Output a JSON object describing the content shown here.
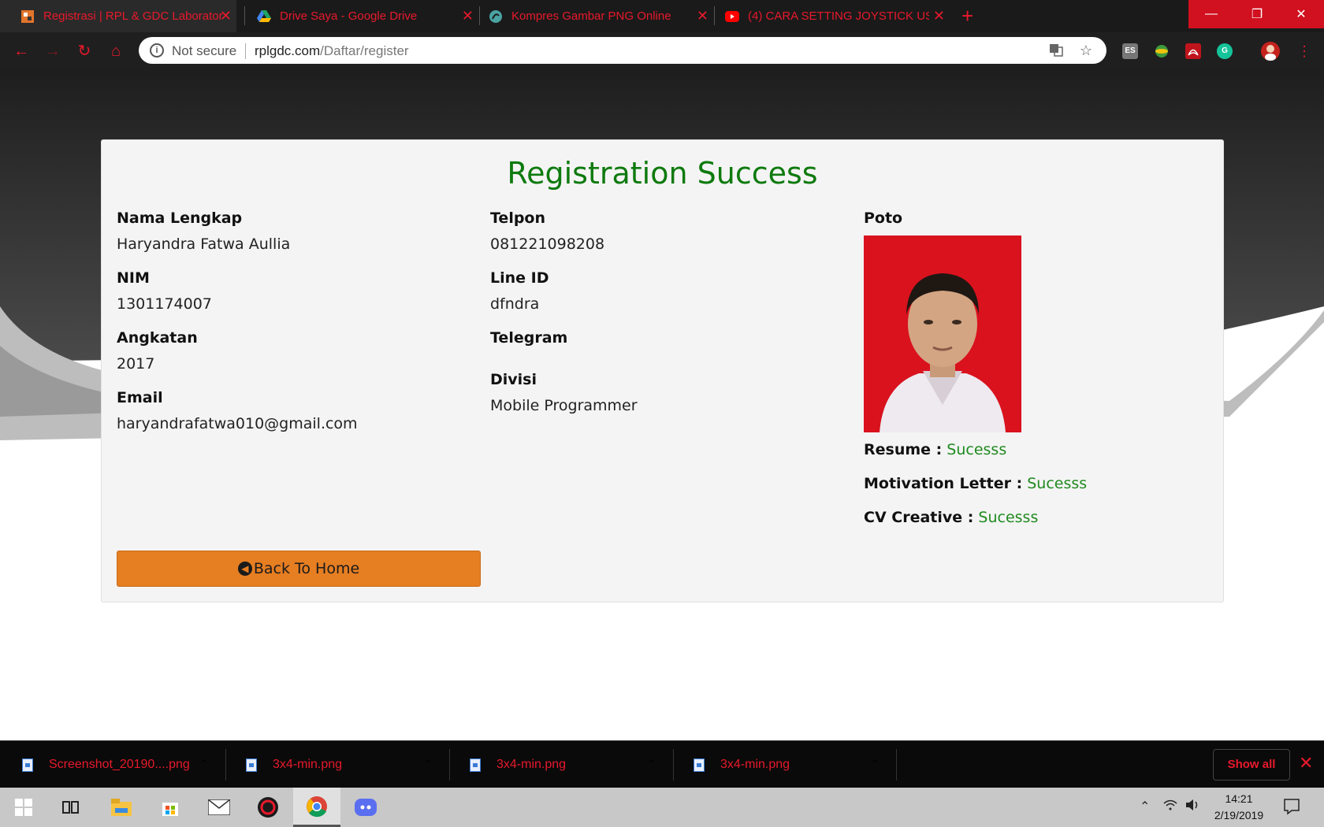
{
  "browser": {
    "tabs": [
      {
        "title": "Registrasi | RPL & GDC Laborator",
        "favicon": "rpl-favicon"
      },
      {
        "title": "Drive Saya - Google Drive",
        "favicon": "google-drive-icon"
      },
      {
        "title": "Kompres Gambar PNG Online",
        "favicon": "compress-icon"
      },
      {
        "title": "(4) CARA SETTING JOYSTICK USE",
        "favicon": "youtube-icon"
      }
    ],
    "close_glyph": "✕",
    "security_label": "Not secure",
    "url_domain": "rplgdc.com",
    "url_path": "/Daftar/register",
    "ext_es_label": "ES"
  },
  "page": {
    "title": "Registration Success",
    "fields_left": [
      {
        "label": "Nama Lengkap",
        "value": "Haryandra Fatwa Aullia"
      },
      {
        "label": "NIM",
        "value": "1301174007"
      },
      {
        "label": "Angkatan",
        "value": "2017"
      },
      {
        "label": "Email",
        "value": "haryandrafatwa010@gmail.com"
      }
    ],
    "fields_middle": [
      {
        "label": "Telpon",
        "value": "081221098208"
      },
      {
        "label": "Line ID",
        "value": "dfndra"
      },
      {
        "label": "Telegram",
        "value": ""
      },
      {
        "label": "Divisi",
        "value": "Mobile Programmer"
      }
    ],
    "photo_label": "Poto",
    "uploads": [
      {
        "label": "Resume :",
        "status": "Sucesss"
      },
      {
        "label": "Motivation Letter :",
        "status": "Sucesss"
      },
      {
        "label": "CV Creative :",
        "status": "Sucesss"
      }
    ],
    "back_button": "Back To Home"
  },
  "downloads": {
    "items": [
      "Screenshot_20190....png",
      "3x4-min.png",
      "3x4-min.png",
      "3x4-min.png"
    ],
    "show_all": "Show all"
  },
  "taskbar": {
    "time": "14:21",
    "date": "2/19/2019"
  },
  "colors": {
    "success_green": "#0e7a0e",
    "button_orange": "#e67e22",
    "chrome_red": "#e8192c"
  }
}
